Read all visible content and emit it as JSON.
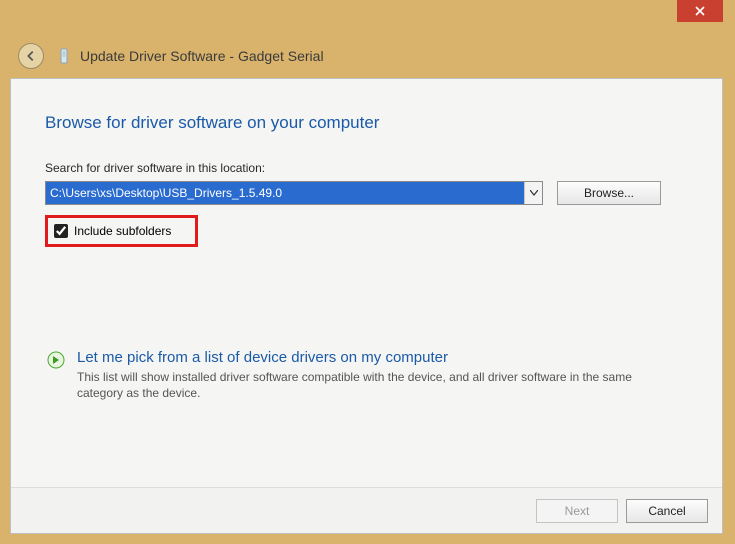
{
  "window": {
    "title": "Update Driver Software - Gadget Serial"
  },
  "page": {
    "heading": "Browse for driver software on your computer",
    "search_label": "Search for driver software in this location:",
    "path_value": "C:\\Users\\xs\\Desktop\\USB_Drivers_1.5.49.0",
    "browse_label": "Browse...",
    "include_subfolders_label": "Include subfolders",
    "include_subfolders_checked": true
  },
  "alt_option": {
    "title": "Let me pick from a list of device drivers on my computer",
    "description": "This list will show installed driver software compatible with the device, and all driver software in the same category as the device."
  },
  "footer": {
    "next_label": "Next",
    "cancel_label": "Cancel"
  }
}
